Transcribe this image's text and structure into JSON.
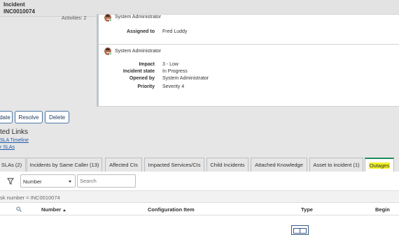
{
  "header": {
    "title": "Incident",
    "number": "INC0010074"
  },
  "activity": {
    "label": "Activities: 2",
    "entries": [
      {
        "author": "System Administrator",
        "fields": [
          {
            "label": "Assigned to",
            "value": "Fred Luddy"
          }
        ]
      },
      {
        "author": "System Administrator",
        "fields": [
          {
            "label": "Impact",
            "value": "3 - Low"
          },
          {
            "label": "Incident state",
            "value": "In Progress"
          },
          {
            "label": "Opened by",
            "value": "System Administrator"
          },
          {
            "label": "Priority",
            "value": "Severity 4"
          }
        ]
      }
    ]
  },
  "actions": {
    "update": "date",
    "resolve": "Resolve",
    "delete": "Delete"
  },
  "related_links": {
    "title": "ted Links",
    "links": [
      "SLA Timeline",
      "r SLAs"
    ]
  },
  "tabs": [
    "SLAs (2)",
    "Incidents by Same Caller (13)",
    "Affected CIs",
    "Impacted Services/CIs",
    "Child Incidents",
    "Attached Knowledge",
    "Asset to incident (1)",
    "Outages"
  ],
  "active_tab": "Outages",
  "list": {
    "filter_field": "Number",
    "search_placeholder": "Search",
    "breadcrumb": "sk number = INC0010074",
    "columns": [
      "Number",
      "Configuration Item",
      "Type",
      "Begin"
    ]
  },
  "colors": {
    "accent": "#1f8a5b",
    "highlight": "#f2f22a",
    "link": "#1f5aa6",
    "presence": "#33a456"
  },
  "icons": [
    "avatar",
    "presence-dot",
    "filter-icon",
    "caret-down-icon",
    "search-icon",
    "sort-ascending-icon",
    "outage-type-icon"
  ]
}
